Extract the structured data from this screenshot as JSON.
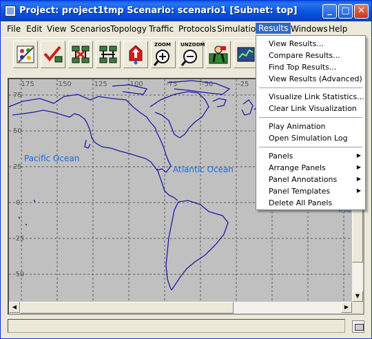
{
  "window": {
    "title": "Project: project1tmp Scenario: scenario1  [Subnet: top]"
  },
  "menubar": {
    "items": [
      "File",
      "Edit",
      "View",
      "Scenarios",
      "Topology",
      "Traffic",
      "Protocols",
      "Simulation",
      "Results",
      "Windows",
      "Help"
    ]
  },
  "toolbar": {
    "zoom_label": "ZOOM",
    "unzoom_label": "UNZOOM",
    "icons": [
      "open-palette-icon",
      "check-links-icon",
      "fail-links-icon",
      "recover-links-icon",
      "return-to-parent-icon",
      "zoom-in-icon",
      "zoom-out-icon",
      "configure-simulation-icon",
      "view-results-icon"
    ]
  },
  "map": {
    "x_ticks": [
      "-175",
      "-150",
      "-125",
      "-100",
      "-75",
      "-50",
      "-25"
    ],
    "y_ticks": [
      "75",
      "50",
      "25",
      "0",
      "-25",
      "-50"
    ],
    "labels": {
      "pacific": "Pacific Ocean",
      "atlantic": "Atlantic Ocean",
      "partial": "Ind"
    }
  },
  "results_menu": {
    "items": [
      {
        "label": "View Results...",
        "submenu": false
      },
      {
        "label": "Compare Results...",
        "submenu": false
      },
      {
        "label": "Find Top Results...",
        "submenu": false
      },
      {
        "label": "View Results (Advanced)",
        "submenu": false
      },
      {
        "label": "Visualize Link Statistics...",
        "submenu": false
      },
      {
        "label": "Clear Link Visualization",
        "submenu": false
      },
      {
        "label": "Play Animation",
        "submenu": false
      },
      {
        "label": "Open Simulation Log",
        "submenu": false
      },
      {
        "label": "Panels",
        "submenu": true
      },
      {
        "label": "Arrange Panels",
        "submenu": true
      },
      {
        "label": "Panel Annotations",
        "submenu": true
      },
      {
        "label": "Panel Templates",
        "submenu": true
      },
      {
        "label": "Delete All Panels",
        "submenu": false
      }
    ]
  },
  "colors": {
    "titlebar": "#0a5ae8",
    "menu_highlight": "#316ac5",
    "map_background": "#c0c0c0",
    "coastline": "#1a1aa8",
    "ocean_label": "#1e6ad6"
  }
}
